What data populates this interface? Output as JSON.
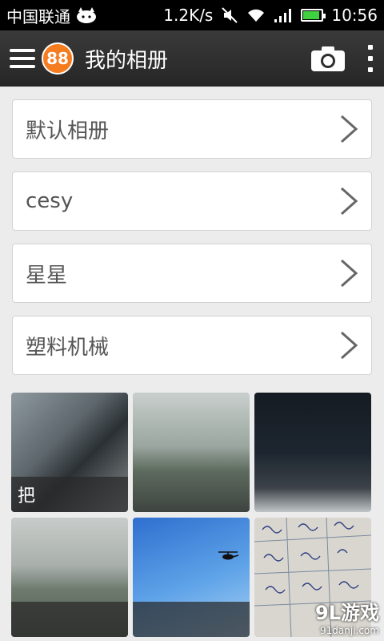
{
  "status_bar": {
    "carrier": "中国联通",
    "speed": "1.2K/s",
    "time": "10:56",
    "battery_level": 0.9,
    "icons": [
      "cat-icon",
      "mute-icon",
      "wifi-icon",
      "signal-icon",
      "battery-icon"
    ]
  },
  "app_bar": {
    "logo_text": "88",
    "title": "我的相册",
    "icons": [
      "menu-icon",
      "camera-icon",
      "more-icon"
    ]
  },
  "albums": [
    {
      "label": "默认相册"
    },
    {
      "label": "cesy"
    },
    {
      "label": "星星"
    },
    {
      "label": "塑料机械"
    }
  ],
  "photos": [
    {
      "caption": "把"
    },
    {
      "caption": ""
    },
    {
      "caption": ""
    },
    {
      "caption": ""
    },
    {
      "caption": ""
    },
    {
      "caption": ""
    }
  ],
  "watermark": {
    "brand": "9L游戏",
    "site": "91danji.com"
  },
  "colors": {
    "appbar": "#2e2e2e",
    "logo": "#f57c1f",
    "battery": "#3fd13f"
  }
}
